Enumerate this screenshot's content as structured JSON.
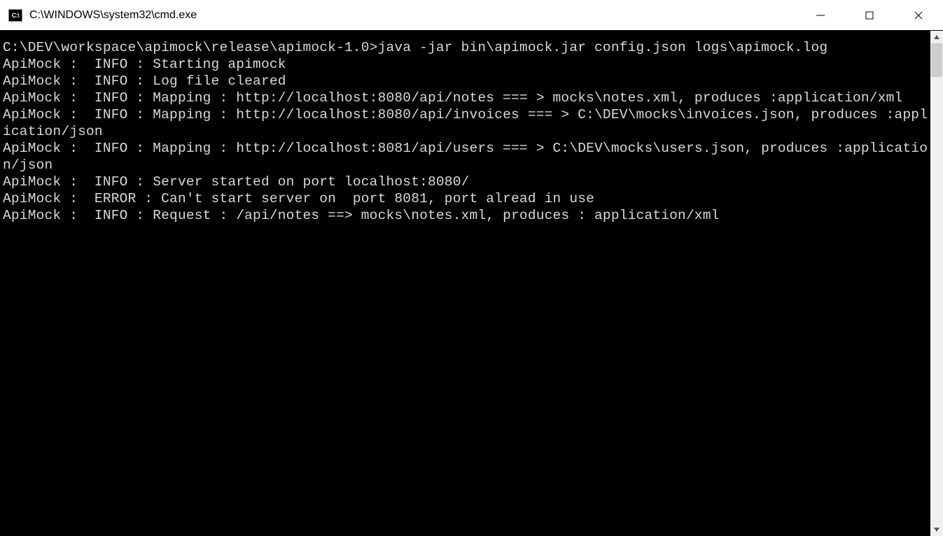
{
  "window": {
    "title": "C:\\WINDOWS\\system32\\cmd.exe",
    "icon_label": "C:\\"
  },
  "terminal": {
    "prompt": "C:\\DEV\\workspace\\apimock\\release\\apimock-1.0>",
    "command": "java -jar bin\\apimock.jar config.json logs\\apimock.log",
    "lines": [
      "ApiMock :  INFO : Starting apimock",
      "ApiMock :  INFO : Log file cleared",
      "ApiMock :  INFO : Mapping : http://localhost:8080/api/notes === > mocks\\notes.xml, produces :application/xml",
      "ApiMock :  INFO : Mapping : http://localhost:8080/api/invoices === > C:\\DEV\\mocks\\invoices.json, produces :application/json",
      "ApiMock :  INFO : Mapping : http://localhost:8081/api/users === > C:\\DEV\\mocks\\users.json, produces :application/json",
      "ApiMock :  INFO : Server started on port localhost:8080/",
      "ApiMock :  ERROR : Can't start server on  port 8081, port alread in use",
      "ApiMock :  INFO : Request : /api/notes ==> mocks\\notes.xml, produces : application/xml"
    ]
  }
}
